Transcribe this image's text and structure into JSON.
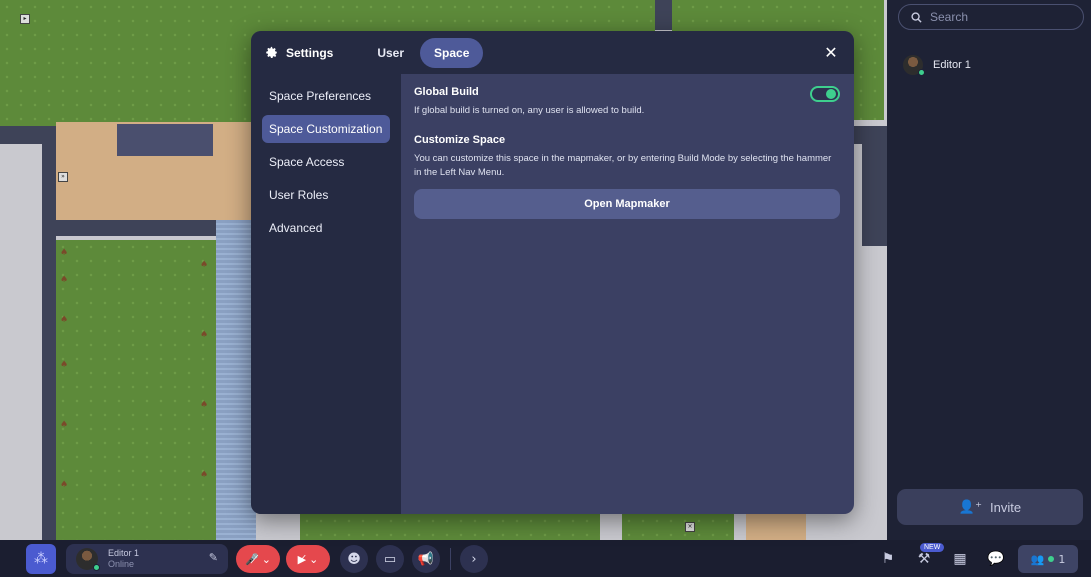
{
  "modal": {
    "title": "Settings",
    "tabs": [
      {
        "label": "User"
      },
      {
        "label": "Space"
      }
    ],
    "nav": [
      {
        "label": "Space Preferences"
      },
      {
        "label": "Space Customization"
      },
      {
        "label": "Space Access"
      },
      {
        "label": "User Roles"
      },
      {
        "label": "Advanced"
      }
    ],
    "active_nav": "Space Customization",
    "sections": {
      "global_build": {
        "title": "Global Build",
        "description": "If global build is turned on, any user is allowed to build.",
        "enabled": true
      },
      "customize_space": {
        "title": "Customize Space",
        "description": "You can customize this space in the mapmaker, or by entering Build Mode by selecting the hammer in the Left Nav Menu.",
        "button_label": "Open Mapmaker"
      }
    }
  },
  "sidebar": {
    "search_placeholder": "Search",
    "users": [
      {
        "name": "Editor 1",
        "status_color": "#3ecf8e"
      }
    ],
    "invite_label": "Invite"
  },
  "bottombar": {
    "profile_name": "Editor 1",
    "profile_status": "Online",
    "new_badge": "NEW",
    "online_count": "1"
  },
  "colors": {
    "accent": "#4e5a99",
    "online": "#3ecf8e",
    "danger": "#e5484d"
  }
}
